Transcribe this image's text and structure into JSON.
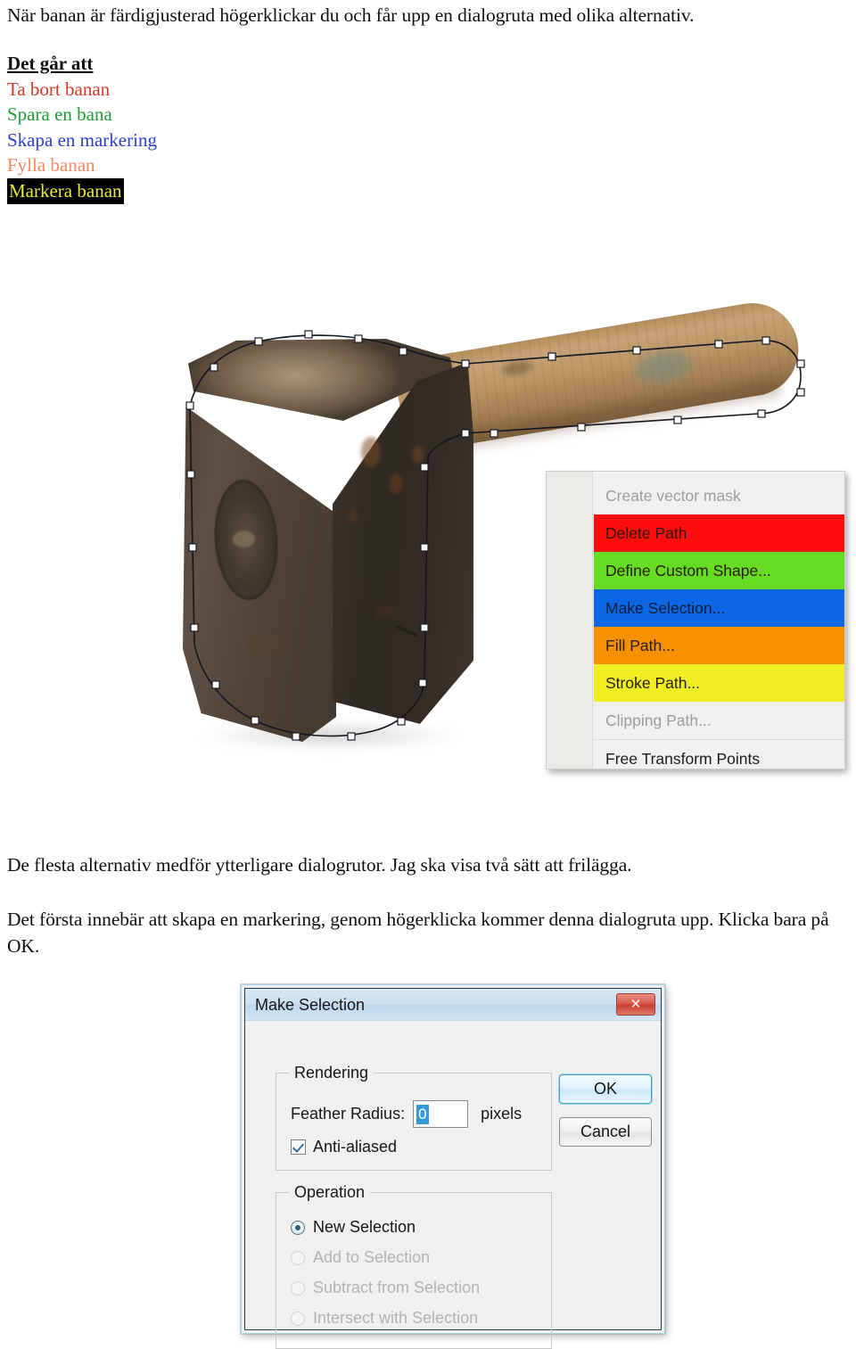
{
  "document": {
    "intro_paragraph": "När banan är färdigjusterad högerklickar du och får upp en dialogruta med olika alternativ.",
    "options_heading": "Det går att",
    "options": [
      {
        "label": "Ta bort banan",
        "color": "#d63a26",
        "background": "transparent"
      },
      {
        "label": "Spara en bana",
        "color": "#1f9e35",
        "background": "transparent"
      },
      {
        "label": "Skapa en markering",
        "color": "#2a3fd6",
        "background": "transparent"
      },
      {
        "label": "Fylla banan",
        "color": "#f08a63",
        "background": "transparent"
      },
      {
        "label": "Markera banan",
        "color": "#e8e83c",
        "background": "#000000"
      }
    ],
    "paragraph_1": "De flesta alternativ medför ytterligare dialogrutor. Jag ska visa två sätt att frilägga.",
    "paragraph_2": "Det första innebär att skapa en markering, genom högerklicka kommer denna dialogruta upp. Klicka bara på OK."
  },
  "context_menu": {
    "items": [
      {
        "label": "Create vector mask",
        "enabled": false,
        "highlight": "none",
        "separator_above": false
      },
      {
        "label": "Delete Path",
        "enabled": true,
        "highlight": "#ff0d0d",
        "separator_above": false
      },
      {
        "label": "Define Custom Shape...",
        "enabled": true,
        "highlight": "#66dd22",
        "separator_above": false
      },
      {
        "label": "Make Selection...",
        "enabled": true,
        "highlight": "#0b67e2",
        "separator_above": false
      },
      {
        "label": "Fill Path...",
        "enabled": true,
        "highlight": "#f59000",
        "separator_above": false
      },
      {
        "label": "Stroke Path...",
        "enabled": true,
        "highlight": "#eeee22",
        "separator_above": false
      },
      {
        "label": "Clipping Path...",
        "enabled": false,
        "highlight": "none",
        "separator_above": false
      },
      {
        "label": "Free Transform Points",
        "enabled": true,
        "highlight": "none",
        "separator_above": true
      }
    ]
  },
  "dialog": {
    "title": "Make Selection",
    "close_label": "✕",
    "rendering": {
      "legend": "Rendering",
      "feather_label": "Feather Radius:",
      "feather_value": "0",
      "feather_units": "pixels",
      "antialiased_label": "Anti-aliased",
      "antialiased_checked": true
    },
    "operation": {
      "legend": "Operation",
      "options": [
        {
          "label": "New Selection",
          "selected": true,
          "enabled": true
        },
        {
          "label": "Add to Selection",
          "selected": false,
          "enabled": false
        },
        {
          "label": "Subtract from Selection",
          "selected": false,
          "enabled": false
        },
        {
          "label": "Intersect with Selection",
          "selected": false,
          "enabled": false
        }
      ]
    },
    "buttons": {
      "ok": "OK",
      "cancel": "Cancel"
    }
  },
  "photo": {
    "subject": "sledgehammer",
    "path_visible": true
  }
}
